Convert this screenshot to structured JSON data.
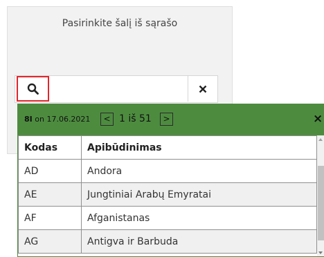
{
  "panel": {
    "title": "Pasirinkite šalį iš sąrašo"
  },
  "search": {
    "search_icon": "search-icon",
    "clear_icon": "close-icon",
    "value": ""
  },
  "popup": {
    "version_code": "8I",
    "version_date": "on 17.06.2021",
    "prev_label": "<",
    "next_label": ">",
    "page_text": "1 iš 51",
    "close_icon": "close-icon",
    "close_label": "×",
    "header_color": "#4d8c3f"
  },
  "table": {
    "headers": {
      "code": "Kodas",
      "description": "Apibūdinimas"
    },
    "rows": [
      {
        "code": "AD",
        "description": "Andora"
      },
      {
        "code": "AE",
        "description": "Jungtiniai Arabų Emyratai"
      },
      {
        "code": "AF",
        "description": "Afganistanas"
      },
      {
        "code": "AG",
        "description": "Antigva ir Barbuda"
      }
    ]
  },
  "colors": {
    "highlight_border": "#e2252b",
    "header_green": "#4d8c3f"
  }
}
